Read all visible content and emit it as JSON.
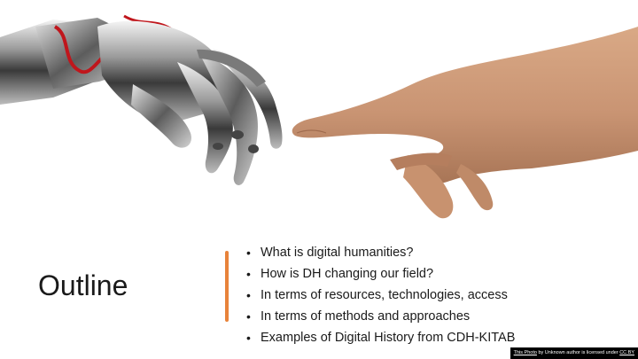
{
  "slide": {
    "title": "Outline",
    "bullets": [
      "What is digital humanities?",
      "How is DH changing our field?",
      "In terms of resources, technologies, access",
      "In terms of methods and approaches",
      "Examples of Digital History from CDH-KITAB"
    ],
    "bullet_glyph": "•",
    "accent_color": "#e8833a",
    "image_credit": {
      "link_text": "This Photo",
      "middle_text": " by Unknown author is licensed under ",
      "license_text": "CC BY"
    }
  }
}
